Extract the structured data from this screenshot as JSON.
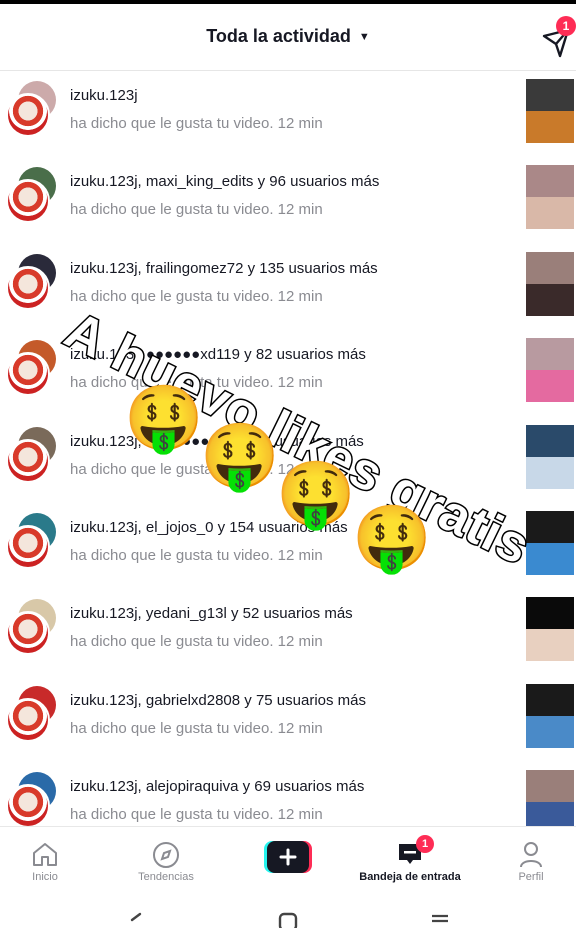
{
  "header": {
    "title": "Toda la actividad",
    "dm_badge": "1"
  },
  "rows": [
    {
      "title": "izuku.123j",
      "sub": "ha dicho que le gusta tu video.",
      "time": "12 min",
      "avatar_color": "#caa",
      "thumb_color": "#3a3a3a",
      "thumb_inner": "#c97a2a"
    },
    {
      "title": "izuku.123j, maxi_king_edits y 96 usuarios más",
      "sub": "ha dicho que le gusta tu video.",
      "time": "12 min",
      "avatar_color": "#4a6e4a",
      "thumb_color": "#a88",
      "thumb_inner": "#d9b8a8"
    },
    {
      "title": "izuku.123j, frailingomez72 y 135 usuarios más",
      "sub": "ha dicho que le gusta tu video.",
      "time": "12 min",
      "avatar_color": "#2a2a3a",
      "thumb_color": "#9a7f7a",
      "thumb_inner": "#3a2a2a"
    },
    {
      "title": "izuku.123j, ●●●●●●xd119 y 82 usuarios más",
      "sub": "ha dicho que le gusta tu video.",
      "time": "12 min",
      "avatar_color": "#c45a2a",
      "thumb_color": "#b89aa0",
      "thumb_inner": "#e46aa0"
    },
    {
      "title": "izuku.123j, ●●●●●●●●●● y ●● usuarios más",
      "sub": "ha dicho que le gusta tu video.",
      "time": "12 min",
      "avatar_color": "#7a6a5a",
      "thumb_color": "#2a4a6a",
      "thumb_inner": "#c8d8e8"
    },
    {
      "title": "izuku.123j, el_jojos_0 y 154 usuarios más",
      "sub": "ha dicho que le gusta tu video.",
      "time": "12 min",
      "avatar_color": "#2a7a8a",
      "thumb_color": "#1a1a1a",
      "thumb_inner": "#3a8ad0"
    },
    {
      "title": "izuku.123j, yedani_g13l y 52 usuarios más",
      "sub": "ha dicho que le gusta tu video.",
      "time": "12 min",
      "avatar_color": "#d8c8a8",
      "thumb_color": "#0a0a0a",
      "thumb_inner": "#e8d0c0"
    },
    {
      "title": "izuku.123j, gabrielxd2808 y 75 usuarios más",
      "sub": "ha dicho que le gusta tu video.",
      "time": "12 min",
      "avatar_color": "#c82a2a",
      "thumb_color": "#1a1a1a",
      "thumb_inner": "#4a8ac8"
    },
    {
      "title": "izuku.123j, alejopiraquiva y 69 usuarios más",
      "sub": "ha dicho que le gusta tu video.",
      "time": "12 min",
      "avatar_color": "#2a6aa8",
      "thumb_color": "#9a7f7a",
      "thumb_inner": "#3a5a9a"
    }
  ],
  "overlay": {
    "text": "A huevo likes gratis",
    "emoji": "🤑"
  },
  "nav": {
    "home": "Inicio",
    "discover": "Tendencias",
    "add": "+",
    "inbox": "Bandeja de entrada",
    "inbox_badge": "1",
    "profile": "Perfil"
  }
}
